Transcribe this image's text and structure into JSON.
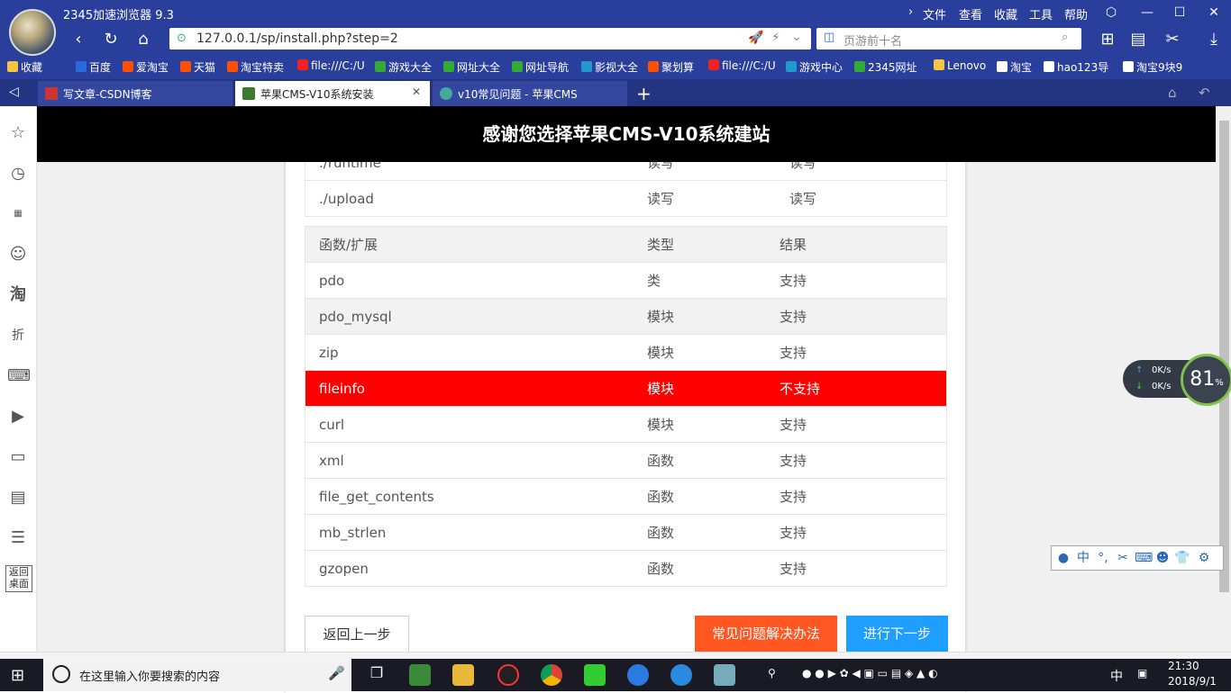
{
  "window": {
    "app_title": "2345加速浏览器 9.3",
    "menu": [
      "文件",
      "查看",
      "收藏",
      "工具",
      "帮助"
    ],
    "controls": {
      "minimize": "—",
      "maximize": "☐",
      "close": "✕"
    }
  },
  "address": {
    "url": "127.0.0.1/sp/install.php?step=2",
    "search_placeholder": "页游前十名"
  },
  "bookmarks": [
    {
      "label": "收藏",
      "color": "#f6c343"
    },
    {
      "label": "百度",
      "color": "#2a6ae0"
    },
    {
      "label": "爱淘宝",
      "color": "#ff5000"
    },
    {
      "label": "天猫",
      "color": "#ff5000"
    },
    {
      "label": "淘宝特卖",
      "color": "#ff5000"
    },
    {
      "label": "file:///C:/U",
      "color": "#e22"
    },
    {
      "label": "游戏大全",
      "color": "#3a3"
    },
    {
      "label": "网址大全",
      "color": "#3a3"
    },
    {
      "label": "网址导航",
      "color": "#3a3"
    },
    {
      "label": "影视大全",
      "color": "#29c"
    },
    {
      "label": "聚划算",
      "color": "#ff5000"
    },
    {
      "label": "file:///C:/U",
      "color": "#e22"
    },
    {
      "label": "游戏中心",
      "color": "#29c"
    },
    {
      "label": "2345网址",
      "color": "#3a3"
    },
    {
      "label": "Lenovo",
      "color": "#f6c343"
    },
    {
      "label": "淘宝",
      "color": "#fff"
    },
    {
      "label": "hao123导",
      "color": "#fff"
    },
    {
      "label": "淘宝9块9",
      "color": "#fff"
    }
  ],
  "tabs": [
    {
      "label": "写文章-CSDN博客",
      "color": "#c33",
      "active": false
    },
    {
      "label": "苹果CMS-V10系统安装",
      "color": "#3a7a2a",
      "active": true
    },
    {
      "label": "v10常见问题 - 苹果CMS",
      "color": "#4a9",
      "active": false
    }
  ],
  "page": {
    "header_title": "感谢您选择苹果CMS-V10系统建站",
    "dir_rows": [
      {
        "path": "./runtime",
        "need": "读写",
        "result": "读写"
      },
      {
        "path": "./upload",
        "need": "读写",
        "result": "读写"
      }
    ],
    "ext_header": {
      "name": "函数/扩展",
      "type": "类型",
      "result": "结果"
    },
    "ext_rows": [
      {
        "name": "pdo",
        "type": "类",
        "result": "支持",
        "style": ""
      },
      {
        "name": "pdo_mysql",
        "type": "模块",
        "result": "支持",
        "style": "gray"
      },
      {
        "name": "zip",
        "type": "模块",
        "result": "支持",
        "style": ""
      },
      {
        "name": "fileinfo",
        "type": "模块",
        "result": "不支持",
        "style": "red"
      },
      {
        "name": "curl",
        "type": "模块",
        "result": "支持",
        "style": ""
      },
      {
        "name": "xml",
        "type": "函数",
        "result": "支持",
        "style": ""
      },
      {
        "name": "file_get_contents",
        "type": "函数",
        "result": "支持",
        "style": ""
      },
      {
        "name": "mb_strlen",
        "type": "函数",
        "result": "支持",
        "style": ""
      },
      {
        "name": "gzopen",
        "type": "函数",
        "result": "支持",
        "style": ""
      }
    ],
    "btn_back": "返回上一步",
    "btn_faq": "常见问题解决办法",
    "btn_next": "进行下一步"
  },
  "sidebar": {
    "back_desktop": "返回桌面"
  },
  "speed": {
    "up": "0K/s",
    "down": "0K/s",
    "percent": "81",
    "percent_unit": "%"
  },
  "taskbar": {
    "search_placeholder": "在这里输入你要搜索的内容",
    "ime": "中",
    "time": "21:30",
    "date": "2018/9/1"
  }
}
